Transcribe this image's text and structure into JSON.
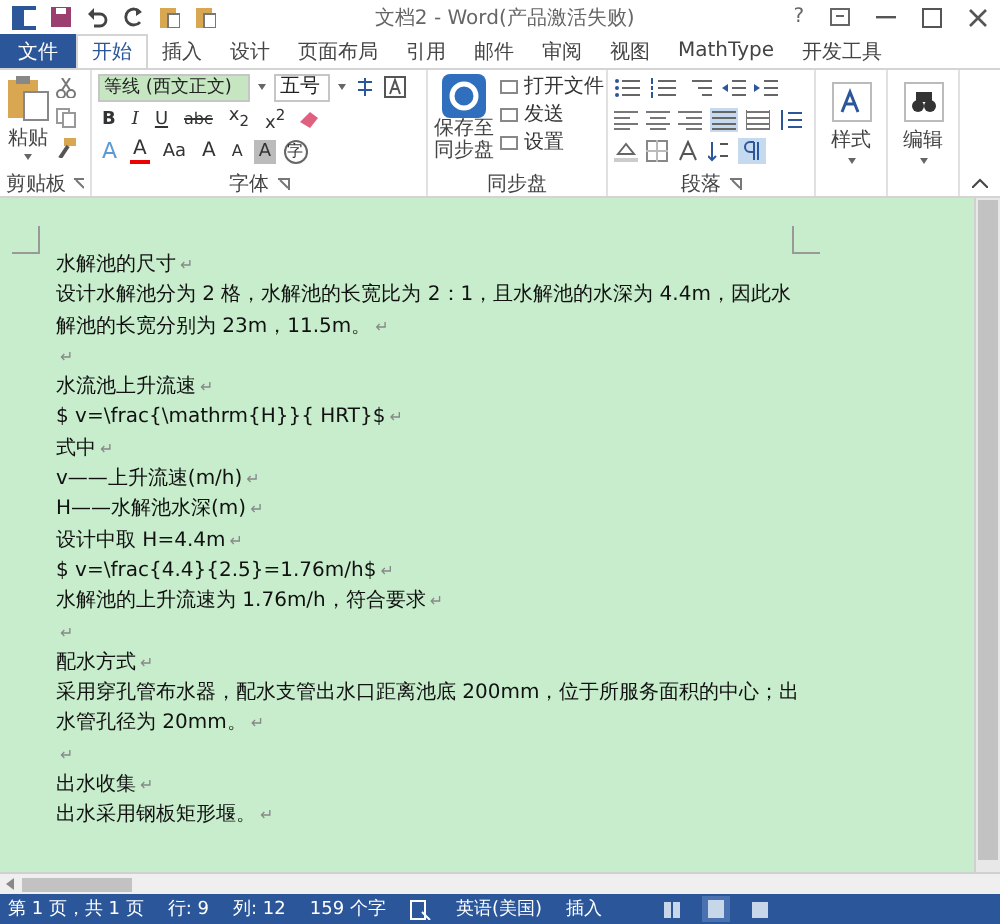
{
  "title_bar": {
    "title": "文档2 - Word(产品激活失败)",
    "help": "?"
  },
  "tabs": [
    {
      "label": "文件",
      "kind": "file",
      "selected": false
    },
    {
      "label": "开始",
      "kind": "tab",
      "selected": true
    },
    {
      "label": "插入",
      "kind": "tab",
      "selected": false
    },
    {
      "label": "设计",
      "kind": "tab",
      "selected": false
    },
    {
      "label": "页面布局",
      "kind": "tab",
      "selected": false
    },
    {
      "label": "引用",
      "kind": "tab",
      "selected": false
    },
    {
      "label": "邮件",
      "kind": "tab",
      "selected": false
    },
    {
      "label": "审阅",
      "kind": "tab",
      "selected": false
    },
    {
      "label": "视图",
      "kind": "tab",
      "selected": false
    },
    {
      "label": "MathType",
      "kind": "tab",
      "selected": false
    },
    {
      "label": "开发工具",
      "kind": "tab",
      "selected": false
    }
  ],
  "ribbon": {
    "clipboard": {
      "label": "剪贴板",
      "paste": "粘贴"
    },
    "font": {
      "label": "字体",
      "font_name": "等线 (西文正文)",
      "font_size": "五号",
      "row_2": [
        "B",
        "I",
        "U",
        "abc",
        "x$_{2}$",
        "x$^{2}$"
      ],
      "row_3": [
        {
          "text": "A",
          "kind": "effects"
        },
        {
          "text": "A",
          "kind": "color"
        },
        {
          "text": "Aa",
          "kind": "plain"
        },
        {
          "text": "A",
          "kind": "grow"
        },
        {
          "text": "A",
          "kind": "shrink"
        },
        {
          "text": "A",
          "kind": "shade"
        },
        {
          "text": "字",
          "kind": "circle"
        }
      ]
    },
    "sync": {
      "label": "同步盘",
      "save": [
        "保存至",
        "同步盘"
      ],
      "items": [
        "打开文件",
        "发送",
        "设置"
      ]
    },
    "paragraph": {
      "label": "段落"
    },
    "styles": {
      "label": "样式"
    },
    "editing": {
      "label": "编辑"
    }
  },
  "document": {
    "paragraphs": [
      {
        "text": "水解池的尺寸",
        "mark": "↵"
      },
      {
        "text": "设计水解池分为 2 格，水解池的长宽比为 2：1，且水解池的水深为 4.4m，因此水解池的长宽分别为 23m，11.5m。",
        "mark": "↵"
      },
      {
        "mark": "↵"
      },
      {
        "text": "水流池上升流速",
        "mark": "↵"
      },
      {
        "text": "$ v=\\frac{\\mathrm{H}}{ HRT}$",
        "mark": "↵"
      },
      {
        "text": "式中",
        "mark": "↵"
      },
      {
        "text": "v——上升流速(m/h)",
        "mark": "↵"
      },
      {
        "text": "H——水解池水深(m)",
        "mark": "↵"
      },
      {
        "text": "设计中取 H=4.4m",
        "mark": "↵"
      },
      {
        "text": "$ v=\\frac{4.4}{2.5}=1.76m/h$",
        "mark": "↵"
      },
      {
        "text": "水解池的上升流速为 1.76m/h，符合要求",
        "mark": "↵"
      },
      {
        "mark": "↵"
      },
      {
        "text": "配水方式",
        "mark": "↵"
      },
      {
        "text": "采用穿孔管布水器，配水支管出水口距离池底 200mm，位于所服务面积的中心；出水管孔径为 20mm。",
        "mark": "↵"
      },
      {
        "mark": "↵"
      },
      {
        "text": "出水收集",
        "mark": "↵"
      },
      {
        "text": "出水采用钢板矩形堰。",
        "mark": "↵"
      }
    ]
  },
  "status_bar": {
    "items": [
      "第 1 页，共 1 页",
      "行: 9",
      "列: 12",
      "159 个字",
      "英语(美国)",
      "插入"
    ]
  }
}
